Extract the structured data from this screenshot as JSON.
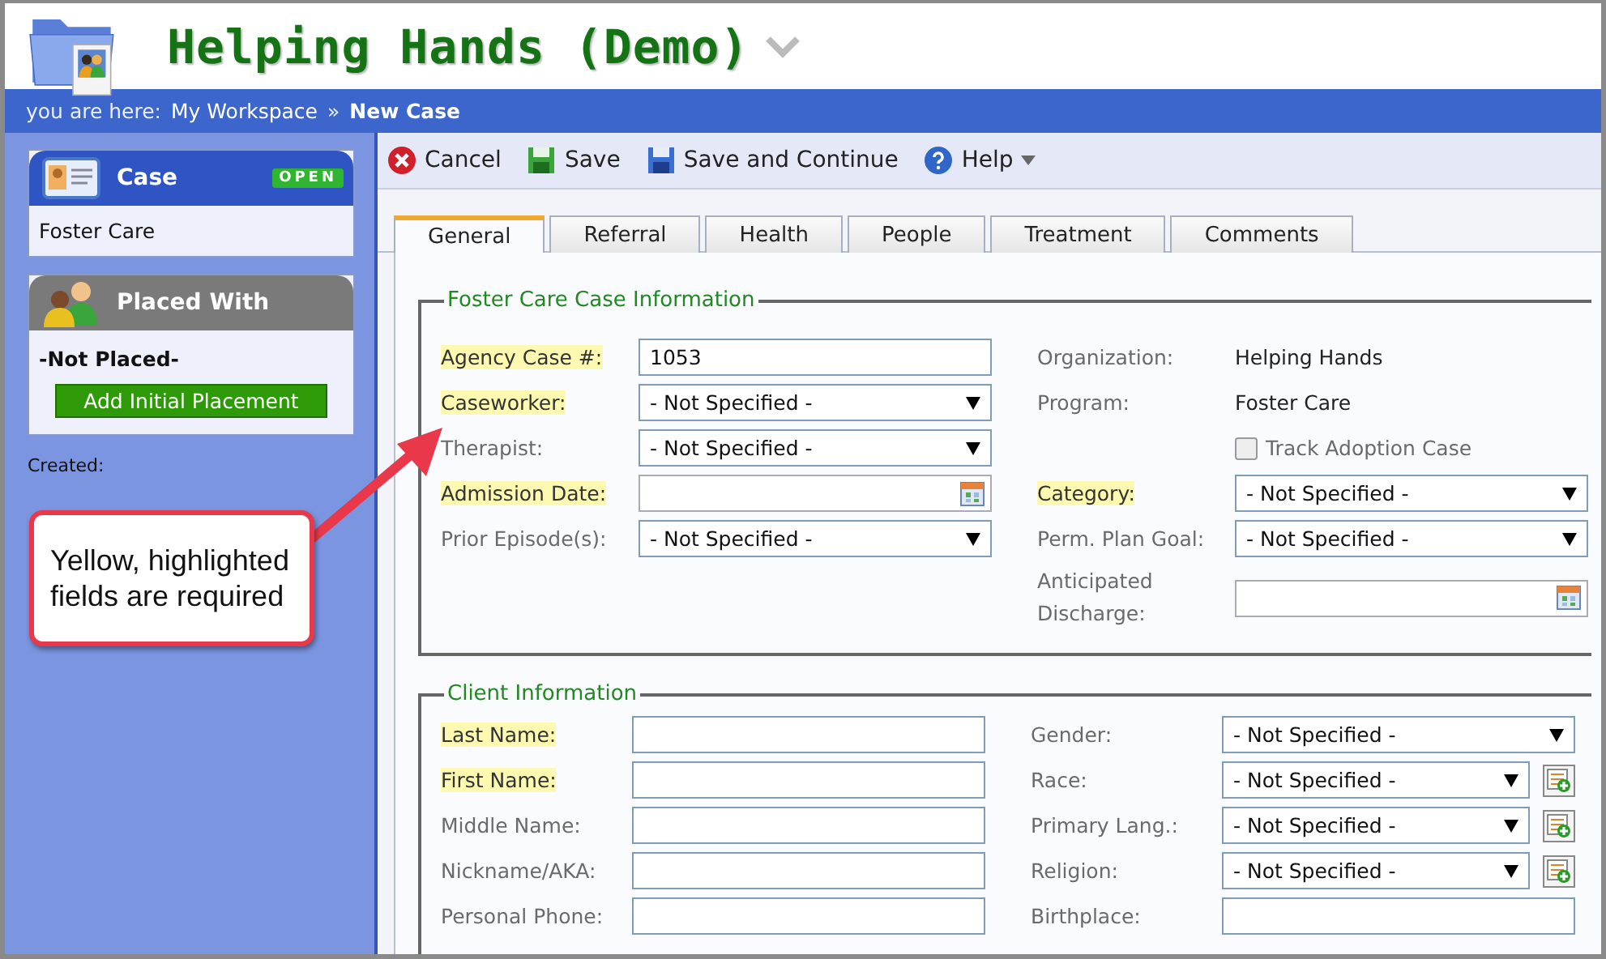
{
  "app": {
    "title": "Helping Hands (Demo)"
  },
  "breadcrumb": {
    "prefix": "you are here:",
    "path": "My Workspace",
    "separator": "»",
    "current": "New Case"
  },
  "sidebar": {
    "case_panel": {
      "title": "Case",
      "badge": "OPEN",
      "value": "Foster Care"
    },
    "placed_panel": {
      "title": "Placed With",
      "value": "-Not Placed-",
      "button": "Add Initial Placement"
    },
    "created_label": "Created:"
  },
  "toolbar": [
    {
      "label": "Cancel",
      "kind": "cancel",
      "menu": false
    },
    {
      "label": "Save",
      "kind": "save",
      "menu": false
    },
    {
      "label": "Save and Continue",
      "kind": "save-continue",
      "menu": false
    },
    {
      "label": "Help",
      "kind": "help",
      "menu": true
    }
  ],
  "tabs": [
    {
      "label": "General",
      "selected": true
    },
    {
      "label": "Referral",
      "selected": false
    },
    {
      "label": "Health",
      "selected": false
    },
    {
      "label": "People",
      "selected": false
    },
    {
      "label": "Treatment",
      "selected": false
    },
    {
      "label": "Comments",
      "selected": false
    }
  ],
  "sections": [
    {
      "title": "Foster Care Case Information",
      "left": [
        {
          "label": "Agency Case #:",
          "kind": "text",
          "value": "1053",
          "required": true
        },
        {
          "label": "Caseworker:",
          "kind": "select",
          "value": "- Not Specified -",
          "required": true
        },
        {
          "label": "Therapist:",
          "kind": "select",
          "value": "- Not Specified -",
          "required": false
        },
        {
          "label": "Admission Date:",
          "kind": "date",
          "required": true
        },
        {
          "label": "Prior Episode(s):",
          "kind": "select",
          "value": "- Not Specified -",
          "required": false
        }
      ],
      "right": [
        {
          "label": "Organization:",
          "kind": "static",
          "value": "Helping Hands",
          "required": false
        },
        {
          "label": "Program:",
          "kind": "static",
          "value": "Foster Care",
          "required": false
        },
        {
          "label": "Track Adoption Case",
          "kind": "checkbox",
          "checked": false
        },
        {
          "label": "Category:",
          "kind": "select",
          "value": "- Not Specified -",
          "required": true
        },
        {
          "label": "Perm. Plan Goal:",
          "kind": "select",
          "value": "- Not Specified -",
          "required": false
        },
        {
          "label": "Anticipated Discharge:",
          "kind": "date",
          "required": false
        }
      ]
    },
    {
      "title": "Client Information",
      "left": [
        {
          "label": "Last Name:",
          "kind": "text",
          "required": true
        },
        {
          "label": "First Name:",
          "kind": "text",
          "required": true
        },
        {
          "label": "Middle Name:",
          "kind": "text",
          "required": false
        },
        {
          "label": "Nickname/AKA:",
          "kind": "text",
          "required": false
        },
        {
          "label": "Personal Phone:",
          "kind": "text",
          "required": false
        }
      ],
      "right": [
        {
          "label": "Gender:",
          "kind": "select",
          "value": "- Not Specified -",
          "required": false,
          "addable": false
        },
        {
          "label": "Race:",
          "kind": "select",
          "value": "- Not Specified -",
          "required": false,
          "addable": true
        },
        {
          "label": "Primary Lang.:",
          "kind": "select",
          "value": "- Not Specified -",
          "required": false,
          "addable": true
        },
        {
          "label": "Religion:",
          "kind": "select",
          "value": "- Not Specified -",
          "required": false,
          "addable": true
        },
        {
          "label": "Birthplace:",
          "kind": "text",
          "required": false,
          "addable": false
        }
      ]
    }
  ],
  "callout": {
    "text": "Yellow, highlighted fields are required"
  }
}
